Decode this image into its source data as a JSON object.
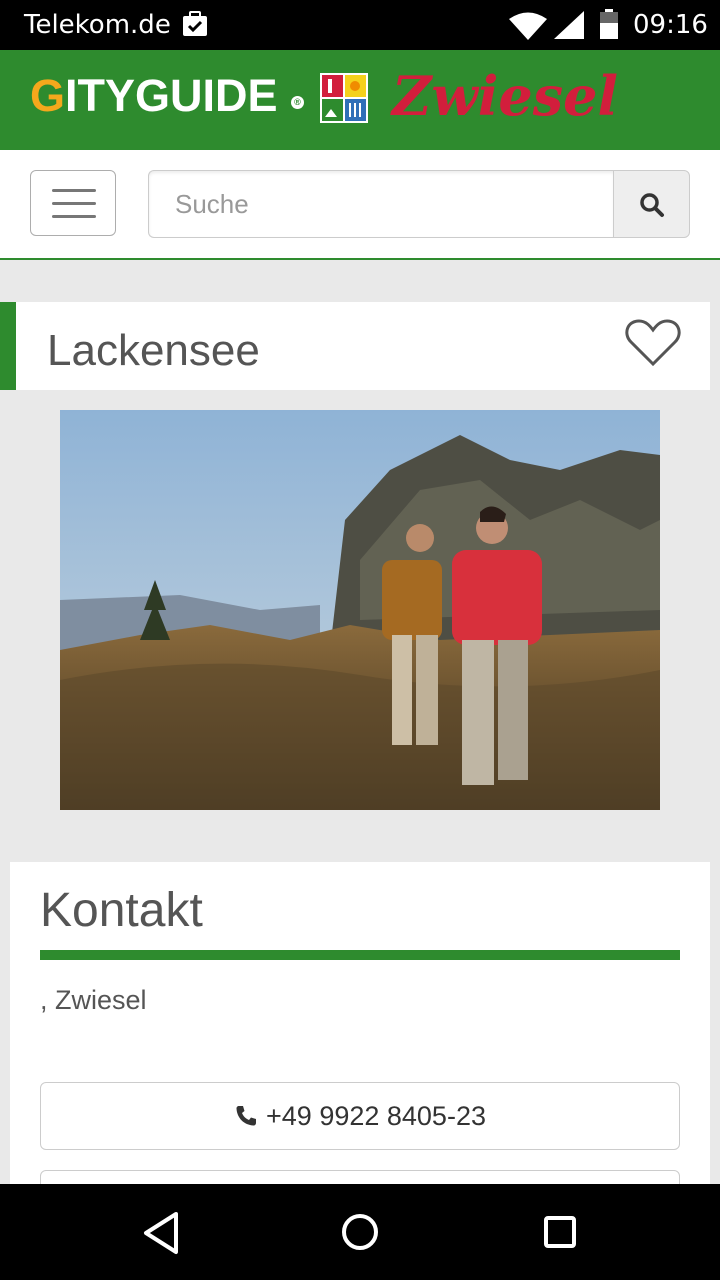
{
  "status_bar": {
    "carrier": "Telekom.de",
    "time": "09:16"
  },
  "header": {
    "logo_g": "G",
    "logo_rest": "ITYGUIDE",
    "logo_reg": "®",
    "city_name": "Zwiesel",
    "colors": {
      "header_bg": "#2e8b2e",
      "city_red": "#d21e3c",
      "logo_orange": "#f5a81c"
    }
  },
  "search": {
    "placeholder": "Suche"
  },
  "page": {
    "title": "Lackensee"
  },
  "contact": {
    "heading": "Kontakt",
    "address": ", Zwiesel",
    "phone": "+49 9922 8405-23"
  },
  "icons": [
    "wifi-icon",
    "signal-icon",
    "battery-icon",
    "menu-icon",
    "search-icon",
    "heart-icon",
    "phone-icon",
    "back-icon",
    "home-icon",
    "recents-icon"
  ]
}
